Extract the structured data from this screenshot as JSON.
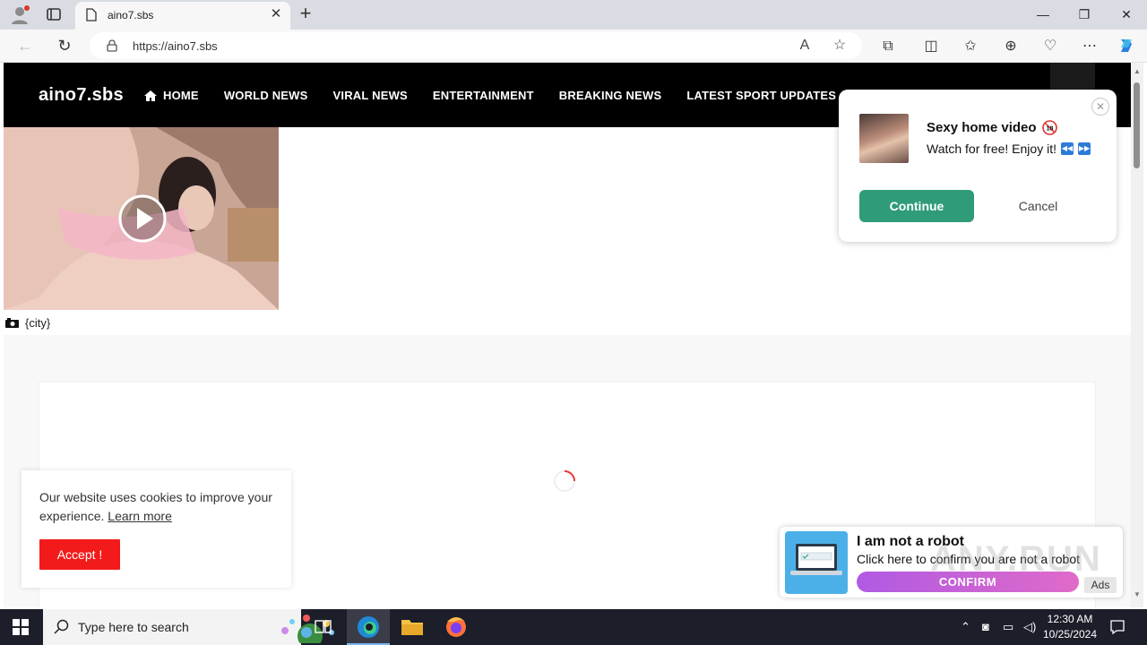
{
  "browser": {
    "tab_title": "aino7.sbs",
    "url": "https://aino7.sbs"
  },
  "site": {
    "logo": "aino7.sbs",
    "menu": [
      {
        "label": "HOME",
        "icon": "home-icon"
      },
      {
        "label": "WORLD NEWS"
      },
      {
        "label": "VIRAL NEWS"
      },
      {
        "label": "ENTERTAINMENT"
      },
      {
        "label": "BREAKING NEWS"
      },
      {
        "label": "LATEST SPORT UPDATES"
      }
    ],
    "video_caption": "{city}"
  },
  "cookie": {
    "message": "Our website uses cookies to improve your experience.",
    "learn_more": "Learn more",
    "accept": "Accept !"
  },
  "notification": {
    "title": "Sexy home video",
    "subtitle": "Watch for free! Enjoy it!",
    "continue": "Continue",
    "cancel": "Cancel"
  },
  "robot_ad": {
    "heading": "I am not a robot",
    "description": "Click here to confirm you are not a robot",
    "button": "CONFIRM",
    "ads_label": "Ads"
  },
  "watermark": "ANY.RUN",
  "taskbar": {
    "search_placeholder": "Type here to search",
    "time": "12:30 AM",
    "date": "10/25/2024"
  },
  "colors": {
    "header_bg": "#000000",
    "accept_button": "#f21a1a",
    "continue_button": "#2f9b79",
    "confirm_gradient_start": "#b05ae3",
    "taskbar_bg": "#1c1f2a"
  }
}
